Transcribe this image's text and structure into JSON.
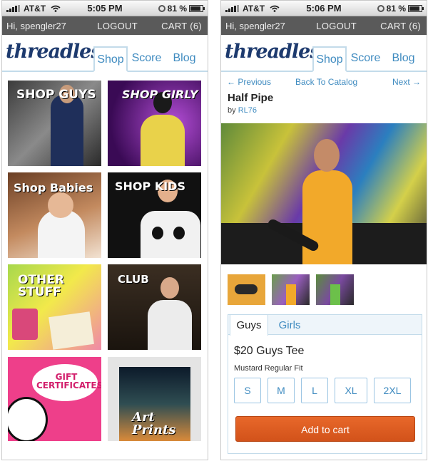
{
  "left": {
    "status": {
      "carrier": "AT&T",
      "time": "5:05 PM",
      "battery": "81 %"
    },
    "userbar": {
      "greeting": "Hi, spengler27",
      "logout": "LOGOUT",
      "cart": "CART (6)"
    },
    "logo": "threadless",
    "tabs": [
      "Shop",
      "Score",
      "Blog"
    ],
    "tiles": [
      {
        "label": "SHOP GUYS"
      },
      {
        "label": "SHOP GIRLY"
      },
      {
        "label": "Shop Babies"
      },
      {
        "label": "SHOP KIDS"
      },
      {
        "label": "OTHER STUFF"
      },
      {
        "label": "CLUB"
      },
      {
        "label": "GIFT CERTIFICATES!"
      },
      {
        "label": "Art Prints"
      }
    ]
  },
  "right": {
    "status": {
      "carrier": "AT&T",
      "time": "5:06 PM",
      "battery": "81 %"
    },
    "userbar": {
      "greeting": "Hi, spengler27",
      "logout": "LOGOUT",
      "cart": "CART (6)"
    },
    "logo": "threadless",
    "tabs": [
      "Shop",
      "Score",
      "Blog"
    ],
    "nav": {
      "previous": "← Previous",
      "catalog": "Back To Catalog",
      "next": "Next →"
    },
    "product": {
      "title": "Half Pipe",
      "by_prefix": "by",
      "artist": "RL76",
      "gender_tabs": [
        "Guys",
        "Girls"
      ],
      "price_line": "$20 Guys Tee",
      "fit": "Mustard Regular Fit",
      "sizes": [
        "S",
        "M",
        "L",
        "XL",
        "2XL"
      ],
      "add_to_cart": "Add to cart"
    }
  },
  "colors": {
    "link": "#3f8bc0",
    "logo": "#1d3a6e",
    "button": "#e05d22",
    "userbar": "#5a5a5a"
  }
}
